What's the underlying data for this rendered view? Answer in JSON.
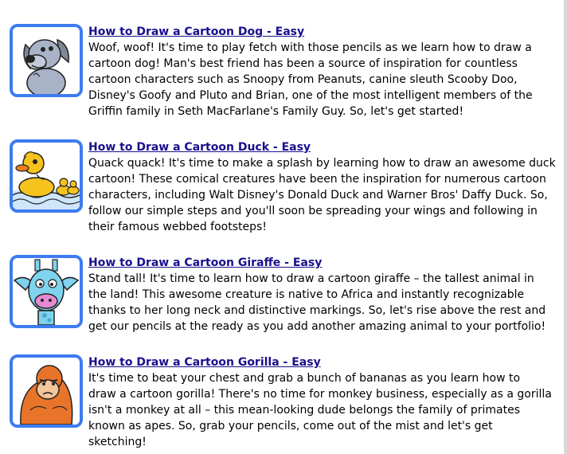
{
  "articles": [
    {
      "title": "How to Draw a Cartoon Dog - Easy",
      "thumbnail_icon": "cartoon-dog-icon",
      "lines": [
        "Woof, woof! It's time to play fetch with those pencils as we learn how to draw a",
        "cartoon dog! Man's best friend has been a source of inspiration for countless",
        "cartoon characters such as Snoopy from Peanuts, canine sleuth Scooby Doo,",
        "Disney's Goofy and Pluto and Brian, one of the most intelligent members of the",
        "Griffin family in Seth MacFarlane's Family Guy. So, let's get started!"
      ]
    },
    {
      "title": "How to Draw a Cartoon Duck - Easy",
      "thumbnail_icon": "cartoon-duck-icon",
      "lines": [
        "Quack quack! It's time to make a splash by learning how to draw an awesome duck",
        "cartoon! These comical creatures have been the inspiration for numerous cartoon",
        "characters, including Walt Disney's Donald Duck and Warner Bros' Daffy Duck. So,",
        "follow our simple steps and you'll soon be spreading your wings and following in",
        "their famous webbed footsteps!"
      ]
    },
    {
      "title": "How to Draw a Cartoon Giraffe - Easy",
      "thumbnail_icon": "cartoon-giraffe-icon",
      "lines": [
        "Stand tall! It's time to learn how to draw a cartoon giraffe – the tallest animal in",
        "the land! This awesome creature is native to Africa and instantly recognizable",
        "thanks to her long neck and distinctive markings. So, let's rise above the rest and",
        "get our pencils at the ready as you add another amazing animal to your portfolio!"
      ]
    },
    {
      "title": "How to Draw a Cartoon Gorilla - Easy",
      "thumbnail_icon": "cartoon-gorilla-icon",
      "lines": [
        "It's time to beat your chest and grab a bunch of bananas as you learn how to",
        "draw a cartoon gorilla! There's no time for monkey business, especially as a gorilla",
        "isn't a monkey at all – this mean-looking dude belongs the family of primates",
        "known as apes. So, grab your pencils, come out of the mist and let's get",
        "sketching!"
      ]
    }
  ],
  "colors": {
    "link": "#1a0f8c",
    "thumbnail_border": "#3c7cf0",
    "text": "#000000"
  }
}
